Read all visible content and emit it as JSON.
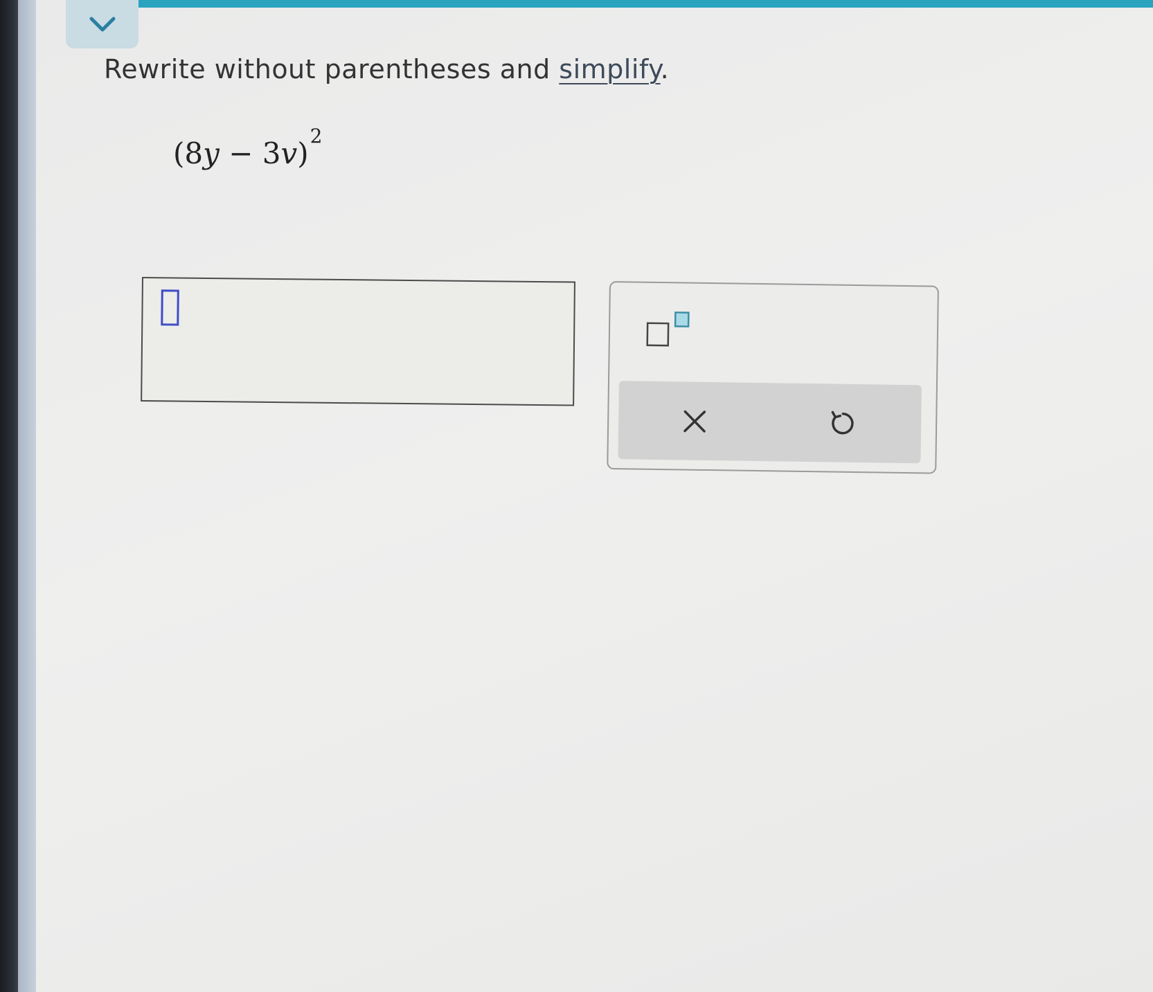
{
  "question": {
    "prompt_text": "Rewrite without parentheses and ",
    "link_text": "simplify",
    "end_punct": "."
  },
  "expression": {
    "open": "(8",
    "var1": "y",
    "mid": "− 3",
    "var2": "v",
    "close": ")",
    "exponent": "2"
  },
  "icons": {
    "collapse": "chevron-down-icon",
    "superscript": "superscript-template-icon",
    "clear": "close-icon",
    "undo": "undo-icon"
  },
  "colors": {
    "accent": "#2aa3bf",
    "cursor": "#3f4cc7",
    "superscript_box": "#5fb3c8"
  }
}
